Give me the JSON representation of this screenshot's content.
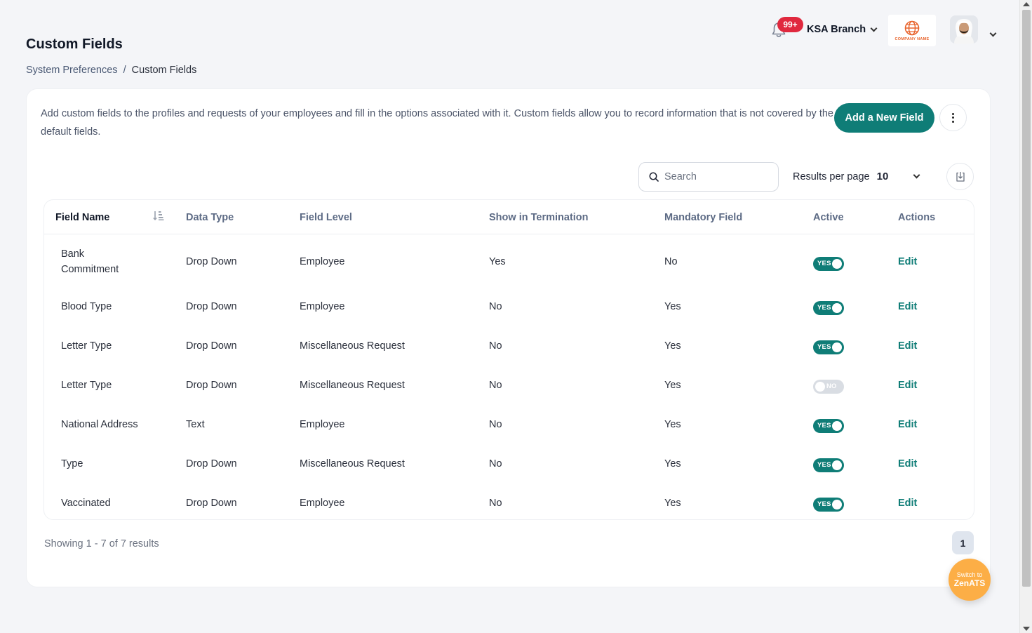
{
  "header": {
    "title": "Custom Fields",
    "breadcrumb": {
      "parent": "System Preferences",
      "separator": "/",
      "current": "Custom Fields"
    },
    "notifications_badge": "99+",
    "branch": "KSA Branch",
    "company_logo_text": "COMPANY NAME"
  },
  "card": {
    "description": "Add custom fields to the profiles and requests of your employees and fill in the options associated with it. Custom fields allow you to record information that is not covered by the default fields.",
    "add_button": "Add a New Field",
    "search_placeholder": "Search",
    "results_per_page_label": "Results per page",
    "results_per_page_value": "10"
  },
  "table": {
    "columns": [
      "Field Name",
      "Data Type",
      "Field Level",
      "Show in Termination",
      "Mandatory Field",
      "Active",
      "Actions"
    ],
    "rows": [
      {
        "name": "Bank Commitment",
        "type": "Drop Down",
        "level": "Employee",
        "termination": "Yes",
        "mandatory": "No",
        "active": true,
        "active_label": "YES",
        "action": "Edit"
      },
      {
        "name": "Blood Type",
        "type": "Drop Down",
        "level": "Employee",
        "termination": "No",
        "mandatory": "Yes",
        "active": true,
        "active_label": "YES",
        "action": "Edit"
      },
      {
        "name": "Letter Type",
        "type": "Drop Down",
        "level": "Miscellaneous Request",
        "termination": "No",
        "mandatory": "Yes",
        "active": true,
        "active_label": "YES",
        "action": "Edit"
      },
      {
        "name": "Letter Type",
        "type": "Drop Down",
        "level": "Miscellaneous Request",
        "termination": "No",
        "mandatory": "Yes",
        "active": false,
        "active_label": "NO",
        "action": "Edit"
      },
      {
        "name": "National Address",
        "type": "Text",
        "level": "Employee",
        "termination": "No",
        "mandatory": "Yes",
        "active": true,
        "active_label": "YES",
        "action": "Edit"
      },
      {
        "name": "Type",
        "type": "Drop Down",
        "level": "Miscellaneous Request",
        "termination": "No",
        "mandatory": "Yes",
        "active": true,
        "active_label": "YES",
        "action": "Edit"
      },
      {
        "name": "Vaccinated",
        "type": "Drop Down",
        "level": "Employee",
        "termination": "No",
        "mandatory": "Yes",
        "active": true,
        "active_label": "YES",
        "action": "Edit"
      }
    ]
  },
  "footer": {
    "showing": "Showing 1 - 7 of 7 results",
    "current_page": "1"
  },
  "zen_button": {
    "line1": "Switch to",
    "line2": "ZenATS"
  },
  "colors": {
    "accent": "#0f7d77",
    "badge": "#e0283e",
    "zen": "#fcae46"
  }
}
